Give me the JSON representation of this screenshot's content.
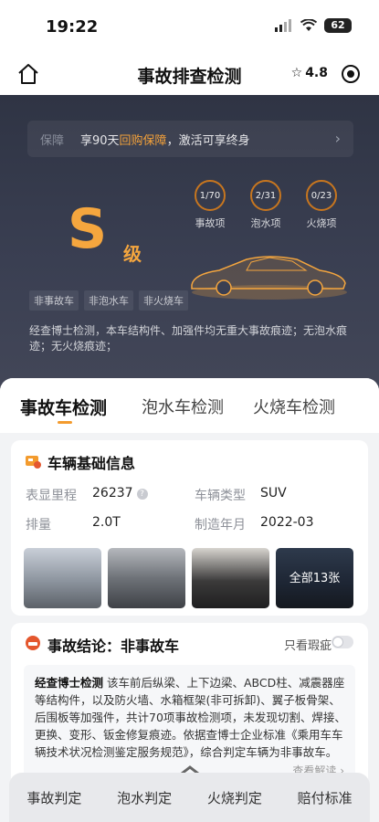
{
  "status": {
    "time": "19:22",
    "battery": "62"
  },
  "nav": {
    "title": "事故排查检测",
    "rating": "4.8"
  },
  "guarantee": {
    "tag": "保障",
    "text_before": "享90天",
    "highlight": "回购保障",
    "text_after": "，激活可享终身"
  },
  "grade": {
    "letter": "S",
    "unit": "级"
  },
  "stats": [
    {
      "value": "1/70",
      "label": "事故项"
    },
    {
      "value": "2/31",
      "label": "泡水项"
    },
    {
      "value": "0/23",
      "label": "火烧项"
    }
  ],
  "tags": [
    "非事故车",
    "非泡水车",
    "非火烧车"
  ],
  "hero_desc": "经查博士检测，本车结构件、加强件均无重大事故痕迹；无泡水痕迹；无火烧痕迹；",
  "tabs": [
    "事故车检测",
    "泡水车检测",
    "火烧车检测"
  ],
  "vehicle_info": {
    "title": "车辆基础信息",
    "mileage_label": "表显里程",
    "mileage": "26237",
    "type_label": "车辆类型",
    "type": "SUV",
    "displacement_label": "排量",
    "displacement": "2.0T",
    "date_label": "制造年月",
    "date": "2022-03",
    "photos_more": "全部13张"
  },
  "conclusion": {
    "title": "事故结论：非事故车",
    "toggle_label": "只看瑕疵",
    "lead": "经查博士检测",
    "text": "该车前后纵梁、上下边梁、ABCD柱、减震器座等结构件，以及防火墙、水箱框架(非可拆卸)、翼子板骨架、后围板等加强件，共计70项事故检测项，未发现切割、焊接、更换、变形、钣金修复痕迹。依据查博士企业标准《乘用车车辆技术状况检测鉴定服务规范》，综合判定车辆为非事故车。",
    "more": "查看解读 ›"
  },
  "bottom_tabs": [
    "事故判定",
    "泡水判定",
    "火烧判定",
    "赔付标准"
  ],
  "colors": {
    "accent": "#f39b2e",
    "hero_bg": "#353a4b"
  }
}
